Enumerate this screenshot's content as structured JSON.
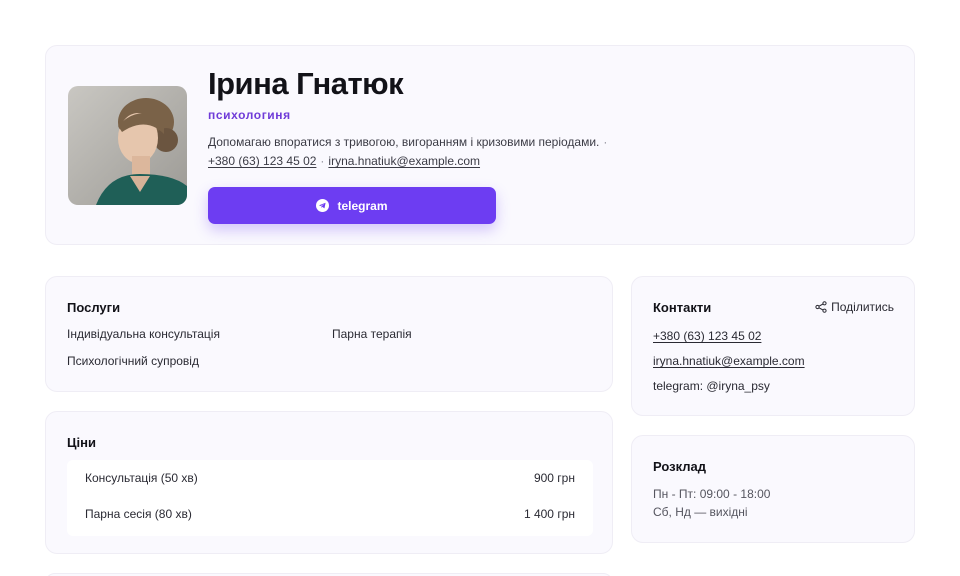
{
  "profile": {
    "name": "Ірина Гнатюк",
    "role": "психологиня",
    "bio": "Допомагаю впоратися з тривогою, вигоранням і кризовими періодами.",
    "phone": "+380 (63) 123 45 02",
    "email": "iryna.hnatiuk@example.com",
    "telegram_button": "telegram"
  },
  "services": {
    "title": "Послуги",
    "items": [
      "Індивідуальна консультація",
      "Парна терапія",
      "Психологічний супровід"
    ]
  },
  "prices": {
    "title": "Ціни",
    "rows": [
      {
        "name": "Консультація (50 хв)",
        "price": "900 грн"
      },
      {
        "name": "Парна сесія (80 хв)",
        "price": "1 400 грн"
      }
    ]
  },
  "contacts": {
    "title": "Контакти",
    "share_label": "Поділитись",
    "phone": "+380 (63) 123 45 02",
    "email": "iryna.hnatiuk@example.com",
    "telegram": "telegram: @iryna_psy"
  },
  "schedule": {
    "title": "Розклад",
    "weekdays": "Пн - Пт: 09:00 - 18:00",
    "weekend": "Сб, Нд — вихідні"
  },
  "colors": {
    "accent": "#6d3df2",
    "role_text": "#6f3bd8",
    "card_bg": "#faf9fe"
  }
}
